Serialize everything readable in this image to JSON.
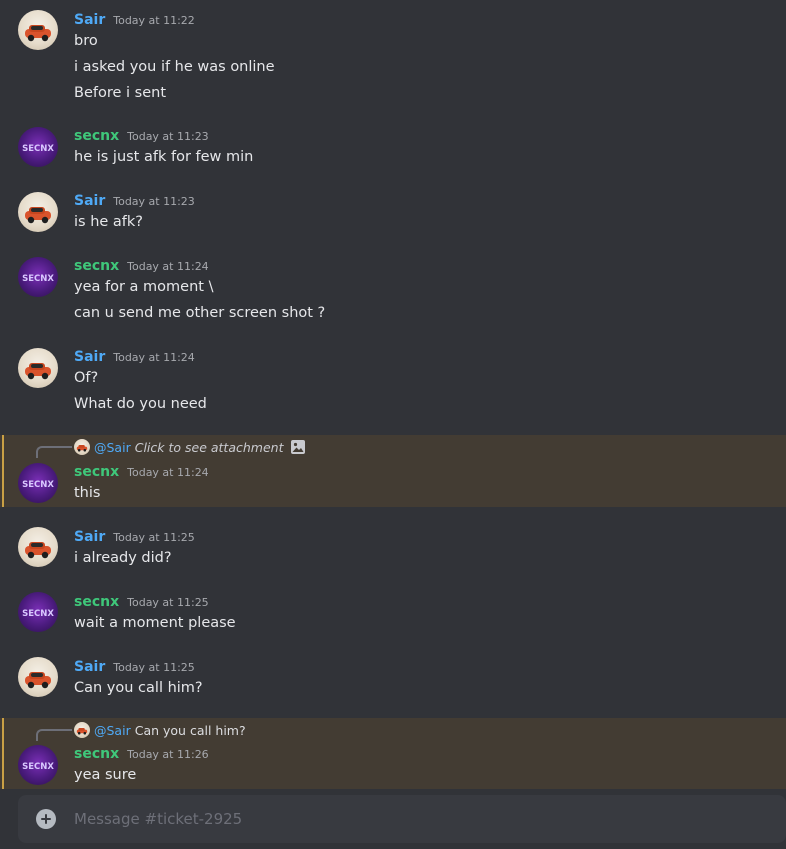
{
  "messages": [
    {
      "user": "Sair",
      "timestamp": "Today at 11:22",
      "lines": [
        "bro",
        "i asked you if he was online",
        "Before i sent"
      ]
    },
    {
      "user": "secnx",
      "timestamp": "Today at 11:23",
      "lines": [
        "he is just afk for few min"
      ]
    },
    {
      "user": "Sair",
      "timestamp": "Today at 11:23",
      "lines": [
        "is he afk?"
      ]
    },
    {
      "user": "secnx",
      "timestamp": "Today at 11:24",
      "lines": [
        "yea for a moment  \\",
        "can u send me other screen shot ?"
      ]
    },
    {
      "user": "Sair",
      "timestamp": "Today at 11:24",
      "lines": [
        "Of?",
        "What do you need"
      ]
    },
    {
      "user": "secnx",
      "timestamp": "Today at 11:24",
      "reply": {
        "mention": "@Sair",
        "text": "Click to see attachment",
        "icon": "image-icon"
      },
      "lines": [
        "this"
      ]
    },
    {
      "user": "Sair",
      "timestamp": "Today at 11:25",
      "lines": [
        "i already did?"
      ]
    },
    {
      "user": "secnx",
      "timestamp": "Today at 11:25",
      "lines": [
        "wait a moment please"
      ]
    },
    {
      "user": "Sair",
      "timestamp": "Today at 11:25",
      "lines": [
        "Can you call him?"
      ]
    },
    {
      "user": "secnx",
      "timestamp": "Today at 11:26",
      "reply": {
        "mention": "@Sair",
        "text": "Can you call him?"
      },
      "lines": [
        "yea sure"
      ]
    }
  ],
  "avatars": {
    "secnx_text": "SECNX"
  },
  "composer": {
    "placeholder": "Message #ticket-2925",
    "add_icon": "plus-circle-icon"
  },
  "colors": {
    "background": "#313338",
    "sair_name": "#4fa9f5",
    "secnx_name": "#3fc77a",
    "mention_highlight": "#433c33",
    "mention_bar": "#c9a045"
  }
}
